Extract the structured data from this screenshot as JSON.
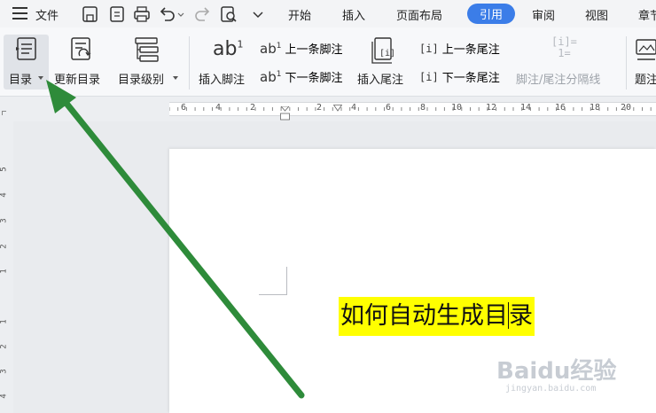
{
  "menubar": {
    "file_label": "文件",
    "tabs": [
      "开始",
      "插入",
      "页面布局",
      "引用",
      "审阅",
      "视图",
      "章节"
    ],
    "active_tab": "引用",
    "accent_color": "#3b7de8"
  },
  "ribbon": {
    "toc_label": "目录",
    "update_toc_label": "更新目录",
    "toc_level_label": "目录级别",
    "insert_footnote_label": "插入脚注",
    "prev_footnote_label": "上一条脚注",
    "next_footnote_label": "下一条脚注",
    "insert_endnote_label": "插入尾注",
    "prev_endnote_label": "上一条尾注",
    "next_endnote_label": "下一条尾注",
    "separator_label": "脚注/尾注分隔线",
    "caption_label": "题注"
  },
  "ruler": {
    "h_numbers": [
      "6",
      "4",
      "2",
      "2",
      "4",
      "6",
      "8",
      "10",
      "12",
      "14",
      "16",
      "18",
      "20"
    ],
    "v_numbers": [
      "5",
      "4",
      "3",
      "2",
      "1",
      "1",
      "2",
      "3",
      "4"
    ]
  },
  "document": {
    "text": "如何自动生成目录",
    "highlight_color": "#ffff00"
  },
  "annotation": {
    "arrow_color": "#2e8b3a"
  },
  "watermark": {
    "brand": "Baidu经验",
    "url": "jingyan.baidu.com"
  }
}
